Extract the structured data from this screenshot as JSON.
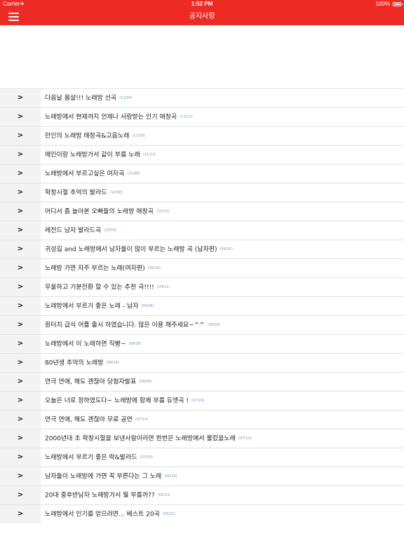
{
  "status_bar": {
    "carrier": "Carrier",
    "wifi_icon": "wifi-icon",
    "time": "1:52 PM",
    "battery_percent": "100%",
    "battery_icon": "battery-icon"
  },
  "nav": {
    "title": "공지사항",
    "menu_icon": "hamburger-menu-icon",
    "color": "#ee2a24"
  },
  "list": {
    "arrow": ">",
    "items": [
      {
        "title": "다음날 몸살!!! 노래방 선곡",
        "date": "(12/04)"
      },
      {
        "title": "노래방에서 현재까지 언제나 사랑받는 인기 애창곡",
        "date": "(11/27)"
      },
      {
        "title": "만인의 노래방 애창곡&고음노래",
        "date": "(11/20)"
      },
      {
        "title": "애인이랑 노래방가서 같이 부를 노래",
        "date": "(11/13)"
      },
      {
        "title": "노래방에서 부르고싶은 여자곡",
        "date": "(11/06)"
      },
      {
        "title": "학창시절 추억의 발라드",
        "date": "(10/30)"
      },
      {
        "title": "어디서 좀 놀아본 오빠들의 노래방 애창곡",
        "date": "(10/23)"
      },
      {
        "title": "레전드 남자 발라드곡",
        "date": "(10/16)"
      },
      {
        "title": "귀성길 and 노래방에서 남자들이 많이 부르는 노래방 곡 (남자편)",
        "date": "(09/25)"
      },
      {
        "title": "노래방 가면 자주 부르는 노래(여자편)",
        "date": "(09/18)"
      },
      {
        "title": "우울하고 기분전환 할 수 있는 추천 곡!!!!",
        "date": "(09/11)"
      },
      {
        "title": "노래방에서 부르기 좋은 노래 - 남자",
        "date": "(09/04)"
      },
      {
        "title": "원터치 급식 어플 출시 하였습니다. 많은 이용 해주세요~^^",
        "date": "(09/03)"
      },
      {
        "title": "노래방에서 이 노래하면 직빵~",
        "date": "(08/28)"
      },
      {
        "title": "80년생 추억의 노래방",
        "date": "(08/14)"
      },
      {
        "title": "연극 연애, 해도 괜찮아 당첨자발표",
        "date": "(08/06)"
      },
      {
        "title": "오늘은 너로 정하였도다~ 노래방에 함께 부를 듀엣곡 !",
        "date": "(07/24)"
      },
      {
        "title": "연극 연애, 해도 괜찮아 무료 공연",
        "date": "(07/14)"
      },
      {
        "title": "2000년대 초 학창시절을 보낸사람이라면 한번은 노래방에서 불렀을노래",
        "date": "(07/10)"
      },
      {
        "title": "노래방에서 부르기 좋은 락&발라드",
        "date": "(07/03)"
      },
      {
        "title": "남자들이 노래방에 가면 꼭 부른다는 그 노래",
        "date": "(06/23)"
      },
      {
        "title": "20대 중후반남자 노래방가서 뭘 부를까??",
        "date": "(06/13)"
      },
      {
        "title": "노래방에서 인기를 얻으려면... 베스트 20곡",
        "date": "(05/22)"
      }
    ]
  }
}
